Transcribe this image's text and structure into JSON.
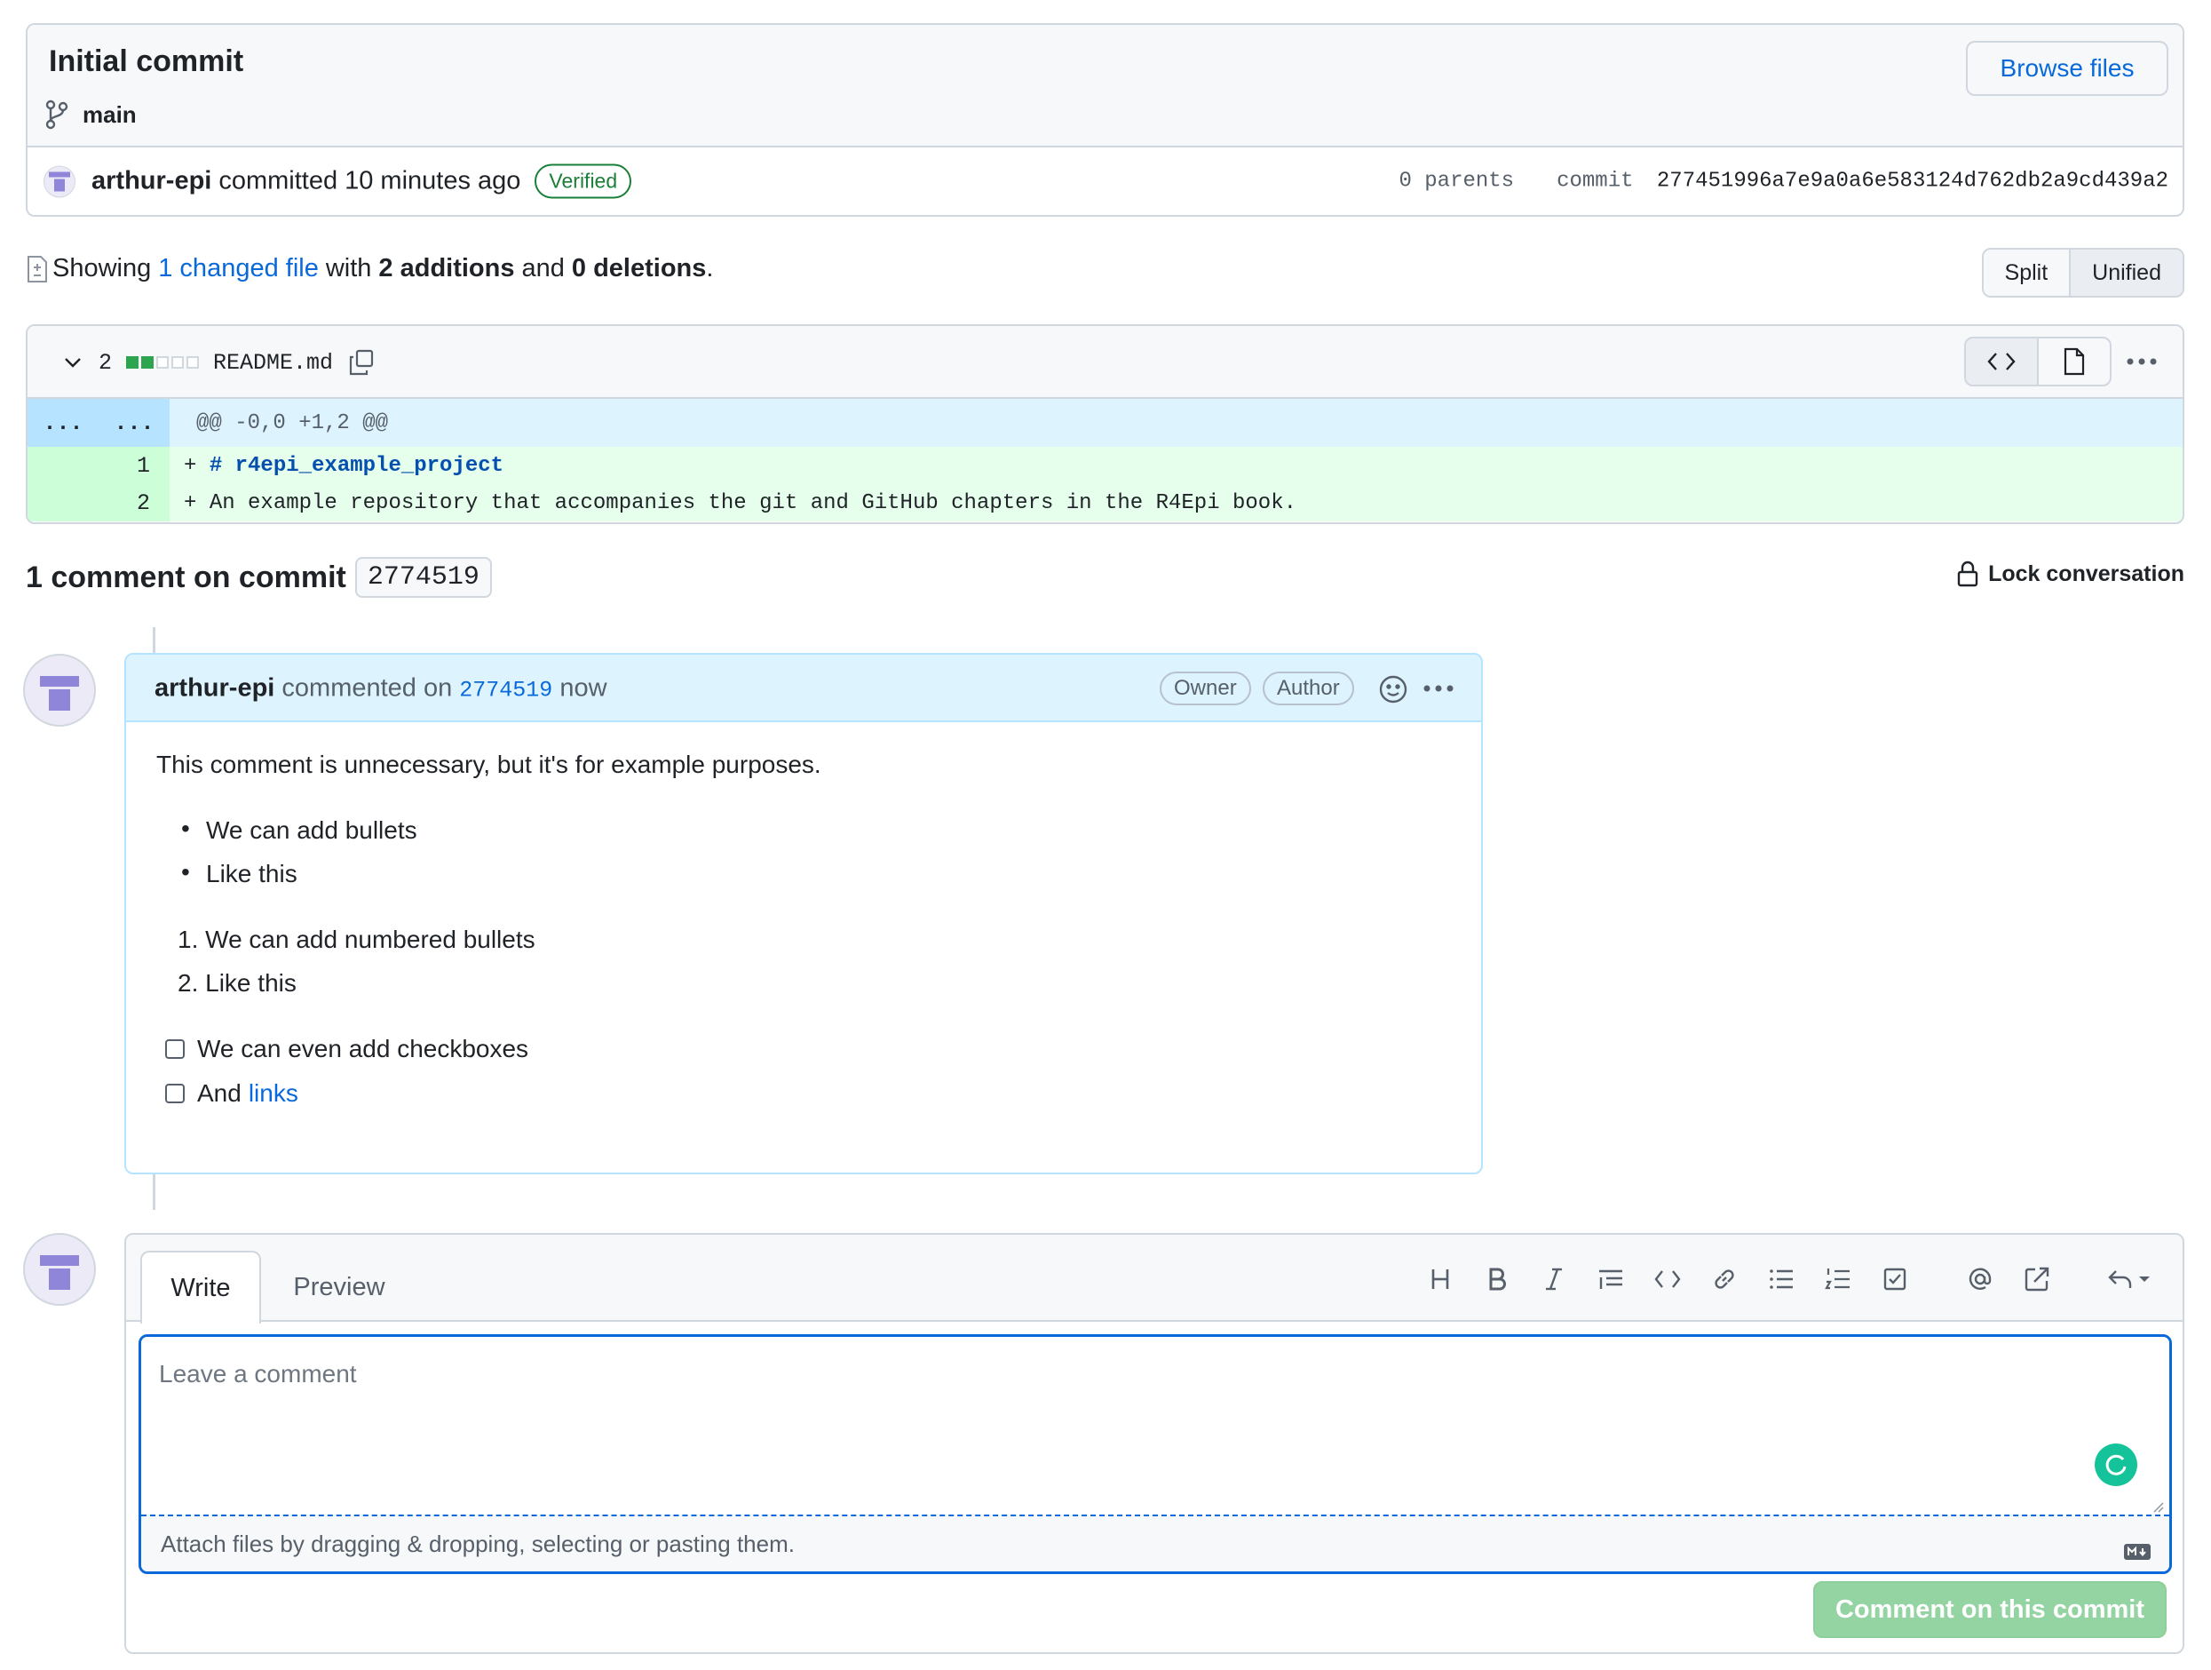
{
  "commit": {
    "title": "Initial commit",
    "branch": "main",
    "browse_label": "Browse files",
    "author": "arthur-epi",
    "action": "committed",
    "time": "10 minutes ago",
    "verified_label": "Verified",
    "parents": "0 parents",
    "commit_label": "commit",
    "sha": "277451996a7e9a0a6e583124d762db2a9cd439a2"
  },
  "summary": {
    "prefix": "Showing",
    "changed_files": "1 changed file",
    "mid1": "with",
    "additions": "2 additions",
    "mid2": "and",
    "deletions": "0 deletions",
    "suffix": "."
  },
  "diff_view": {
    "split_label": "Split",
    "unified_label": "Unified"
  },
  "file": {
    "change_count": "2",
    "name": "README.md",
    "hunk_left": "...",
    "hunk_right": "...",
    "hunk_header": "@@ -0,0 +1,2 @@",
    "lines": [
      {
        "number": "1",
        "prefix": "+ ",
        "text": "# r4epi_example_project"
      },
      {
        "number": "2",
        "prefix": "+ ",
        "text": "An example repository that accompanies the git and GitHub chapters in the R4Epi book."
      }
    ]
  },
  "comments_header": {
    "title": "1 comment on commit",
    "sha_short": "2774519",
    "lock_label": "Lock conversation"
  },
  "comment": {
    "author": "arthur-epi",
    "action": "commented on",
    "sha_link": "2774519",
    "time": "now",
    "badge_owner": "Owner",
    "badge_author": "Author",
    "body": {
      "paragraph": "This comment is unnecessary, but it's for example purposes.",
      "bullets": [
        "We can add bullets",
        "Like this"
      ],
      "numbered": [
        "We can add numbered bullets",
        "Like this"
      ],
      "numbered_markers": [
        "1.",
        "2."
      ],
      "checkbox_1": "We can even add checkboxes",
      "checkbox_2_prefix": "And",
      "checkbox_2_link": "links"
    }
  },
  "composer": {
    "tab_write": "Write",
    "tab_preview": "Preview",
    "placeholder": "Leave a comment",
    "attach_text": "Attach files by dragging & dropping, selecting or pasting them.",
    "submit_label": "Comment on this commit",
    "toolbar_icons": [
      "heading-icon",
      "bold-icon",
      "italic-icon",
      "quote-icon",
      "code-icon",
      "link-icon",
      "unordered-list-icon",
      "ordered-list-icon",
      "task-list-icon",
      "mention-icon",
      "cross-reference-icon",
      "saved-replies-icon"
    ]
  },
  "colors": {
    "accent": "#0969da",
    "success": "#1a7f37",
    "addition_bg": "#e6ffec",
    "hunk_bg": "#ddf4ff",
    "submit_disabled": "#94d3a2"
  }
}
